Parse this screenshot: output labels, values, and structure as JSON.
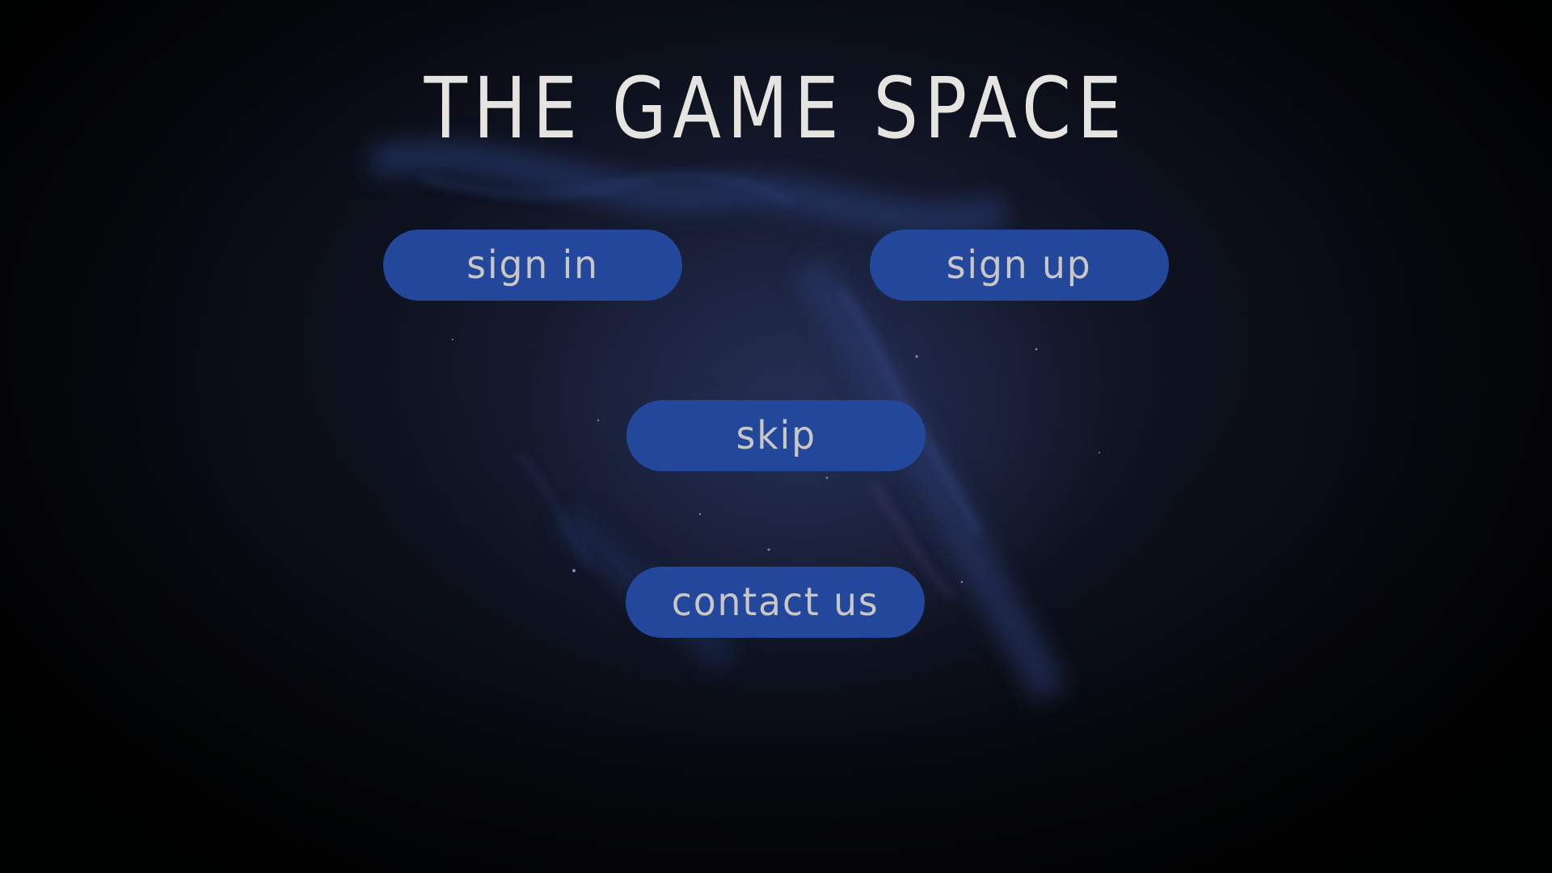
{
  "page": {
    "title": "THE GAME SPACE"
  },
  "buttons": {
    "sign_in": "sign in",
    "sign_up": "sign up",
    "skip": "skip",
    "contact_us": "contact us"
  },
  "colors": {
    "background": "#0b0e18",
    "button": "#23479b",
    "button_text": "#c9c7c5",
    "title_text": "#e6e4e0"
  }
}
